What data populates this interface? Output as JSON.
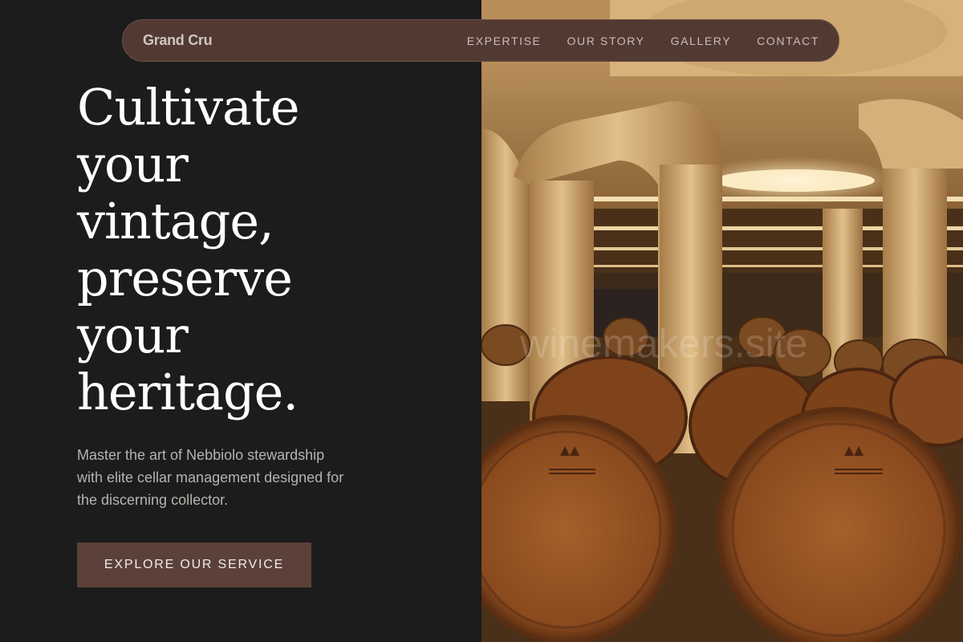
{
  "brand": {
    "name": "Grand Cru"
  },
  "nav": {
    "links": [
      "EXPERTISE",
      "OUR STORY",
      "GALLERY",
      "CONTACT"
    ]
  },
  "hero": {
    "headline_lines": [
      "Cultivate",
      "your",
      "vintage,",
      "preserve",
      "your",
      "heritage."
    ],
    "subtitle_lines": [
      "Master the art of Nebbiolo stewardship",
      "with elite cellar management designed for",
      "the discerning collector."
    ],
    "cta_label": "EXPLORE OUR SERVICE"
  },
  "image": {
    "watermark": "winemakers.site"
  },
  "colors": {
    "background": "#1c1c1c",
    "nav_background": "#523a33",
    "cta_background": "#5b4139",
    "headline": "#ffffff",
    "body_text": "#b7b2af"
  }
}
